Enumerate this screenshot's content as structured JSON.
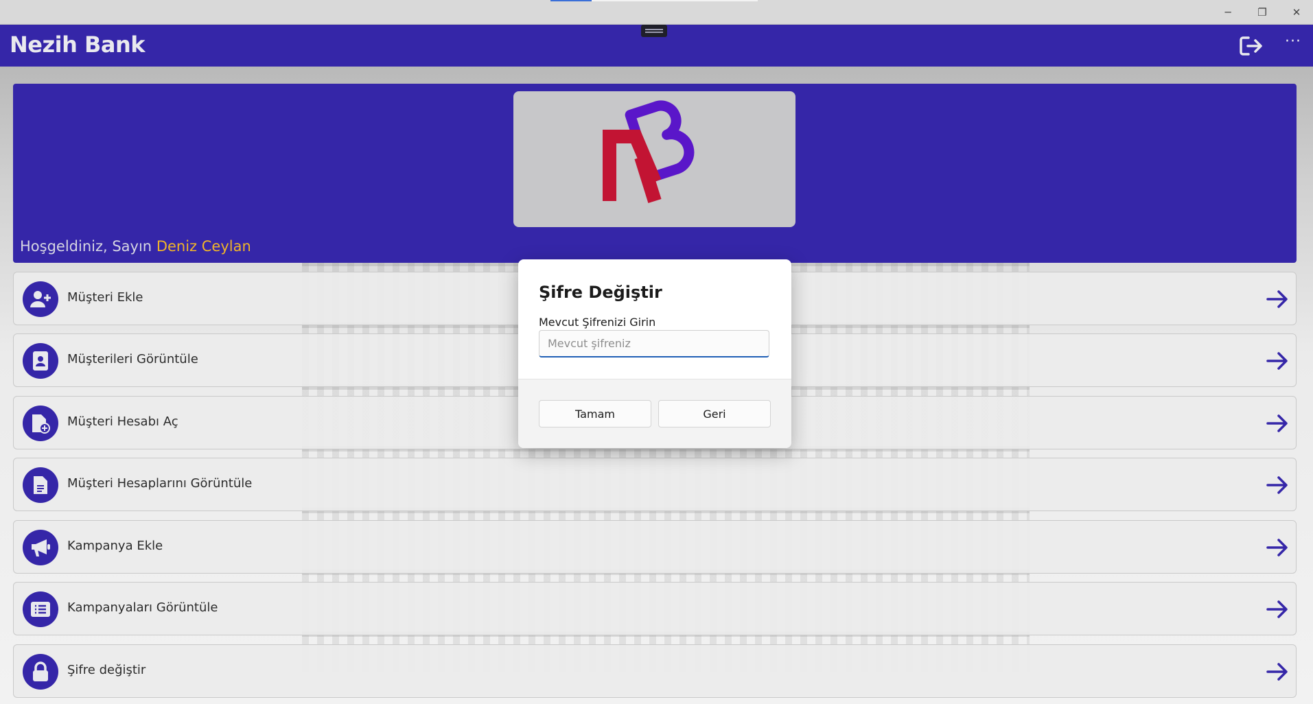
{
  "window": {
    "minimize_glyph": "─",
    "maximize_glyph": "❐",
    "close_glyph": "✕"
  },
  "app": {
    "title": "Nezih Bank",
    "more_glyph": "···",
    "accent": "#3526a8",
    "name_highlight": "#f0b429"
  },
  "banner": {
    "greeting": "Hoşgeldiniz, Sayın",
    "user_name": "Deniz Ceylan"
  },
  "menu": {
    "items": [
      {
        "label": "Müşteri Ekle",
        "icon": "user-plus-icon"
      },
      {
        "label": "Müşterileri Görüntüle",
        "icon": "contact-book-icon"
      },
      {
        "label": "Müşteri Hesabı Aç",
        "icon": "file-plus-icon"
      },
      {
        "label": "Müşteri Hesaplarını Görüntüle",
        "icon": "document-icon"
      },
      {
        "label": "Kampanya Ekle",
        "icon": "megaphone-icon"
      },
      {
        "label": "Kampanyaları Görüntüle",
        "icon": "list-icon"
      },
      {
        "label": "Şifre değiştir",
        "icon": "lock-icon"
      }
    ]
  },
  "dialog": {
    "title": "Şifre Değiştir",
    "field_label": "Mevcut Şifrenizi Girin",
    "field_placeholder": "Mevcut şifreniz",
    "ok_label": "Tamam",
    "back_label": "Geri"
  }
}
